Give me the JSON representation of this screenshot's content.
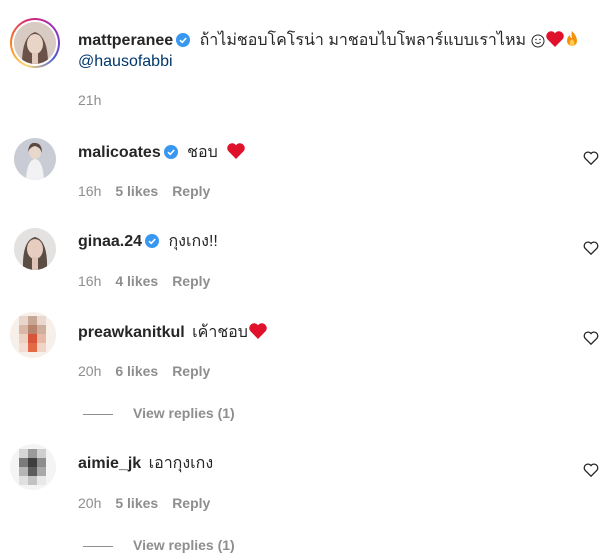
{
  "post": {
    "username": "mattperanee",
    "caption": "ถ้าไม่ชอบโคโรน่า มาชอบไบโพลาร์แบบเราไหม",
    "mention": "@hausofabbi",
    "time": "21h"
  },
  "comments": [
    {
      "username": "malicoates",
      "verified": true,
      "text": "ชอบ",
      "time": "16h",
      "likes": "5 likes",
      "reply": "Reply"
    },
    {
      "username": "ginaa.24",
      "verified": true,
      "text": "กุงเกง!!",
      "time": "16h",
      "likes": "4 likes",
      "reply": "Reply"
    },
    {
      "username": "preawkanitkul",
      "verified": false,
      "text": "เค้าชอบ",
      "time": "20h",
      "likes": "6 likes",
      "reply": "Reply",
      "view_replies": "View replies (1)"
    },
    {
      "username": "aimie_jk",
      "verified": false,
      "text": "เอากุงเกง",
      "time": "20h",
      "likes": "5 likes",
      "reply": "Reply",
      "view_replies": "View replies (1)"
    }
  ],
  "colors": {
    "verified": "#3897f0",
    "heart": "#ed4956",
    "meta": "#8e8e8e",
    "mention": "#00376b"
  }
}
